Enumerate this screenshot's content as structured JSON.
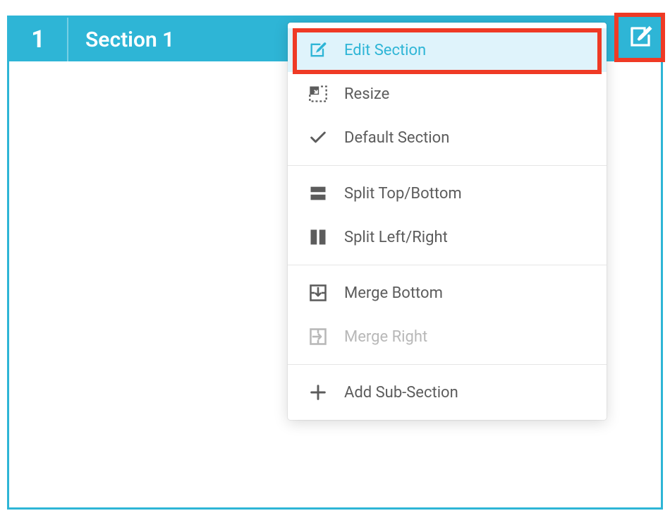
{
  "section": {
    "number": "1",
    "title": "Section 1"
  },
  "menu": {
    "edit_section": "Edit Section",
    "resize": "Resize",
    "default_section": "Default Section",
    "split_top_bottom": "Split Top/Bottom",
    "split_left_right": "Split Left/Right",
    "merge_bottom": "Merge Bottom",
    "merge_right": "Merge Right",
    "add_sub_section": "Add Sub-Section"
  },
  "colors": {
    "accent": "#2eb5d6",
    "highlight": "#ef3a25",
    "active_bg": "#dff3fb",
    "text": "#5c5c5c",
    "disabled": "#b8b8b8"
  }
}
